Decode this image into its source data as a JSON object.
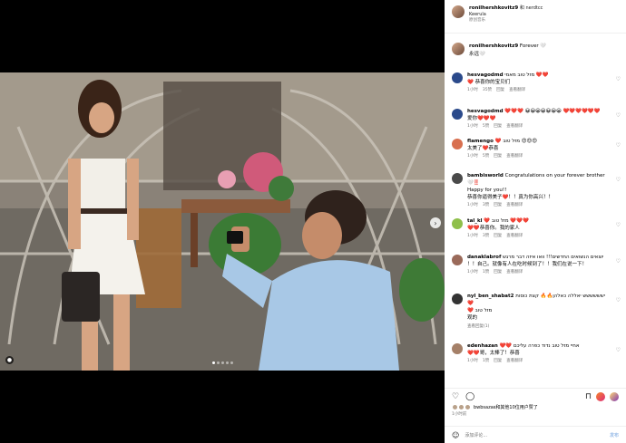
{
  "post": {
    "username": "ronilhershkovitz9",
    "username_suffix": "和 nerdtcc",
    "location": "Keerula",
    "location_sub": "原创音乐"
  },
  "caption": {
    "username": "ronilhershkovitz9",
    "text": "Forever 🤍",
    "translation": "永远🤍"
  },
  "comments": [
    {
      "user": "hesvagodmd",
      "text": "מזל טוב מאמי ❤️❤️",
      "translation": "❤️ 恭喜你的宝贝们",
      "time": "1小时",
      "likes": "35赞",
      "reply": "回复",
      "translate": "查看翻译",
      "avatar": "#2b4a8b"
    },
    {
      "user": "hesvagodmd",
      "text": "❤️❤️❤️ 😀😀😀😀😀😀😀 ❤️❤️❤️❤️❤️❤️",
      "translation": "爱你❤️❤️❤️",
      "time": "1小时",
      "likes": "5赞",
      "reply": "回复",
      "translate": "查看翻译",
      "avatar": "#2b4a8b"
    },
    {
      "user": "flamengo",
      "text": "❤️ מזל טוב 😍😍😍",
      "translation": "太美了❤️恭喜",
      "time": "1小时",
      "likes": "5赞",
      "reply": "回复",
      "translate": "查看翻译",
      "avatar": "#d86f4f"
    },
    {
      "user": "bambisworld",
      "text": "Congratulations on your forever brother 🤍‼️",
      "text2": "Happy for you!!",
      "translation": "恭喜你逼得美子❤️！！真为你高兴！！",
      "time": "1小时",
      "likes": "3赞",
      "reply": "回复",
      "translate": "查看翻译",
      "avatar": "#4a4a4a"
    },
    {
      "user": "tal_kl",
      "text": "❤️ מזל טוב ❤️❤️❤️",
      "translation": "❤️❤️恭喜你。我的家人",
      "time": "1小时",
      "likes": "3赞",
      "reply": "回复",
      "translate": "查看翻译",
      "avatar": "#8fbf4a"
    },
    {
      "user": "danaklabrof",
      "text": "יוצאים הנשואים החדשים!!! וואו איזה דבר מרגש",
      "translation": "！！自己。就像有人在吃时候到了！！我们在说一下！",
      "time": "1小时",
      "likes": "1赞",
      "reply": "回复",
      "translate": "查看翻译",
      "avatar": "#9a6a5a"
    },
    {
      "user": "nyl_ben_shabat2",
      "text": "ישששששש יאללה כאלהן🔥🔥 קצת כוסות ❤️",
      "text2": "❤️ מזל טוב",
      "translation": "观的",
      "time": "",
      "likes": "",
      "reply": "",
      "translate": "",
      "avatar": "#333333",
      "see_replies": "查看回复(1)"
    },
    {
      "user": "edenhazan",
      "text": "❤️❤️ אחיי מזל טוב נדוד כפרה עליכם",
      "translation": "❤️❤️哥，太棒了！恭喜",
      "time": "1小时",
      "likes": "1赞",
      "reply": "回复",
      "translate": "查看翻译",
      "avatar": "#a58068"
    }
  ],
  "actions": {
    "likes_text": "bwbsazas和其他10位用户赞了",
    "time_ago": "1小时前"
  },
  "add_comment": {
    "placeholder": "添加评论...",
    "post_label": "发布"
  },
  "carousel": {
    "count": 5,
    "active": 0
  }
}
